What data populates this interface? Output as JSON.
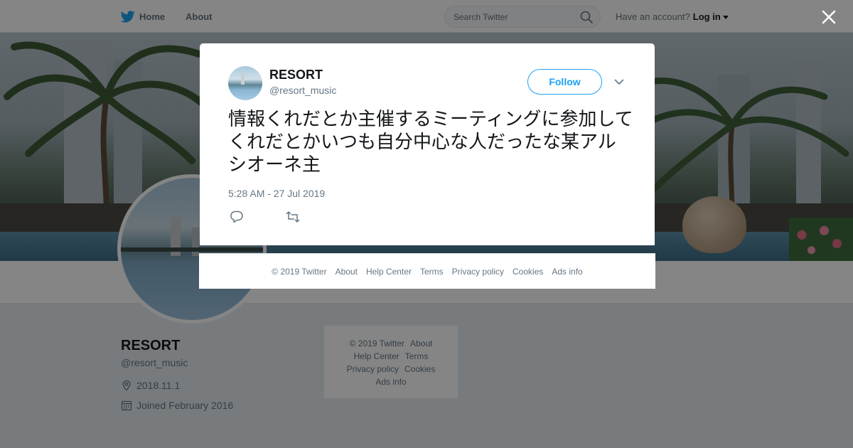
{
  "topbar": {
    "home_label": "Home",
    "about_label": "About",
    "search_placeholder": "Search Twitter",
    "account_prompt": "Have an account?",
    "login_label": "Log in"
  },
  "profile": {
    "name": "RESORT",
    "handle": "@resort_music",
    "location": "2018.11.1",
    "joined": "Joined February 2016"
  },
  "side_footer": {
    "line1": [
      "© 2019 Twitter",
      "About"
    ],
    "line2": [
      "Help Center",
      "Terms"
    ],
    "line3": [
      "Privacy policy",
      "Cookies"
    ],
    "line4": [
      "Ads info"
    ]
  },
  "tweet": {
    "name": "RESORT",
    "handle": "@resort_music",
    "follow_label": "Follow",
    "text": "情報くれだとか主催するミーティングに参加してくれだとかいつも自分中心な人だったな某アルシオーネ主",
    "timestamp": "5:28 AM - 27 Jul 2019"
  },
  "modal_footer": {
    "links": [
      "© 2019 Twitter",
      "About",
      "Help Center",
      "Terms",
      "Privacy policy",
      "Cookies",
      "Ads info"
    ]
  },
  "colors": {
    "brand": "#1da1f2",
    "text_primary": "#14171a",
    "text_secondary": "#657786"
  },
  "icons": {
    "home": "twitter-bird-icon",
    "search": "search-icon",
    "close": "close-icon",
    "more": "chevron-down-icon",
    "reply": "reply-icon",
    "retweet": "retweet-icon",
    "location": "location-pin-icon",
    "calendar": "calendar-icon"
  }
}
